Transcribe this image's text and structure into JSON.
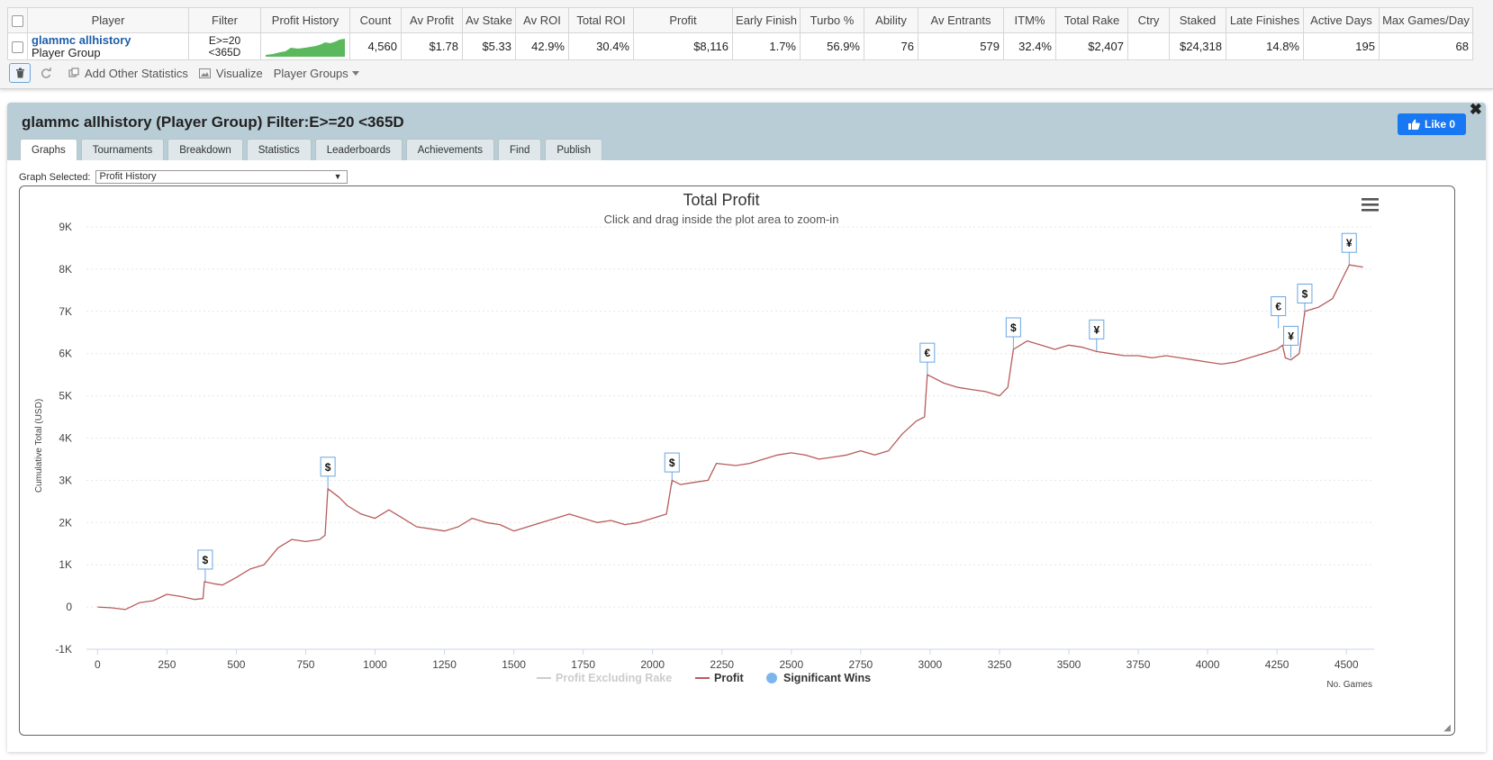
{
  "stats_table": {
    "columns": [
      "Player",
      "Filter",
      "Profit History",
      "Count",
      "Av Profit",
      "Av Stake",
      "Av ROI",
      "Total ROI",
      "Profit",
      "Early Finish",
      "Turbo %",
      "Ability",
      "Av Entrants",
      "ITM%",
      "Total Rake",
      "Ctry",
      "Staked",
      "Late Finishes",
      "Active Days",
      "Max Games/Day"
    ],
    "row": {
      "player_name": "glammc allhistory",
      "player_type": "Player Group",
      "filter": "E>=20 <365D",
      "count": "4,560",
      "av_profit": "$1.78",
      "av_stake": "$5.33",
      "av_roi": "42.9%",
      "total_roi": "30.4%",
      "profit": "$8,116",
      "early_finish": "1.7%",
      "turbo": "56.9%",
      "ability": "76",
      "av_entrants": "579",
      "itm": "32.4%",
      "total_rake": "$2,407",
      "ctry": "",
      "staked": "$24,318",
      "late_finishes": "14.8%",
      "active_days": "195",
      "max_games_day": "68"
    }
  },
  "toolbar": {
    "add_stats": "Add Other Statistics",
    "visualize": "Visualize",
    "player_groups": "Player Groups"
  },
  "panel": {
    "title": "glammc allhistory (Player Group) Filter:E>=20 <365D",
    "like_label": "Like 0",
    "close": "✖",
    "tabs": [
      "Graphs",
      "Tournaments",
      "Breakdown",
      "Statistics",
      "Leaderboards",
      "Achievements",
      "Find",
      "Publish"
    ],
    "active_tab": "Graphs",
    "graph_selected_label": "Graph Selected:",
    "graph_selected_value": "Profit History"
  },
  "colors": {
    "profit_line": "#b85c5c",
    "flag_border": "#6aa6e0",
    "win_dot": "#7cb5ec",
    "legend_grey": "#cccccc"
  },
  "chart_data": {
    "type": "line",
    "title": "Total Profit",
    "subtitle": "Click and drag inside the plot area to zoom-in",
    "ylabel": "Cumulative Total (USD)",
    "xlabel": "No. Games",
    "xlim": [
      -40,
      4600
    ],
    "ylim": [
      -1000,
      9000
    ],
    "x_ticks": [
      0,
      250,
      500,
      750,
      1000,
      1250,
      1500,
      1750,
      2000,
      2250,
      2500,
      2750,
      3000,
      3250,
      3500,
      3750,
      4000,
      4250,
      4500
    ],
    "y_ticks": [
      -1000,
      0,
      1000,
      2000,
      3000,
      4000,
      5000,
      6000,
      7000,
      8000,
      9000
    ],
    "y_tick_labels": [
      "-1K",
      "0",
      "1K",
      "2K",
      "3K",
      "4K",
      "5K",
      "6K",
      "7K",
      "8K",
      "9K"
    ],
    "legend": [
      "Profit Excluding Rake",
      "Profit",
      "Significant Wins"
    ],
    "legend_position": "bottom-center",
    "grid": true,
    "series": [
      {
        "name": "Profit",
        "points": [
          [
            0,
            0
          ],
          [
            50,
            -20
          ],
          [
            100,
            -60
          ],
          [
            150,
            100
          ],
          [
            200,
            150
          ],
          [
            250,
            300
          ],
          [
            300,
            250
          ],
          [
            350,
            180
          ],
          [
            380,
            200
          ],
          [
            385,
            600
          ],
          [
            420,
            550
          ],
          [
            450,
            520
          ],
          [
            500,
            700
          ],
          [
            550,
            900
          ],
          [
            600,
            1000
          ],
          [
            650,
            1400
          ],
          [
            700,
            1600
          ],
          [
            750,
            1550
          ],
          [
            800,
            1600
          ],
          [
            820,
            1700
          ],
          [
            830,
            2800
          ],
          [
            870,
            2600
          ],
          [
            900,
            2400
          ],
          [
            950,
            2200
          ],
          [
            1000,
            2100
          ],
          [
            1050,
            2300
          ],
          [
            1100,
            2100
          ],
          [
            1150,
            1900
          ],
          [
            1200,
            1850
          ],
          [
            1250,
            1800
          ],
          [
            1300,
            1900
          ],
          [
            1350,
            2100
          ],
          [
            1400,
            2000
          ],
          [
            1450,
            1950
          ],
          [
            1500,
            1800
          ],
          [
            1550,
            1900
          ],
          [
            1600,
            2000
          ],
          [
            1650,
            2100
          ],
          [
            1700,
            2200
          ],
          [
            1750,
            2100
          ],
          [
            1800,
            2000
          ],
          [
            1850,
            2050
          ],
          [
            1900,
            1950
          ],
          [
            1950,
            2000
          ],
          [
            2000,
            2100
          ],
          [
            2050,
            2200
          ],
          [
            2070,
            3000
          ],
          [
            2100,
            2900
          ],
          [
            2150,
            2950
          ],
          [
            2200,
            3000
          ],
          [
            2230,
            3400
          ],
          [
            2300,
            3350
          ],
          [
            2350,
            3400
          ],
          [
            2400,
            3500
          ],
          [
            2450,
            3600
          ],
          [
            2500,
            3650
          ],
          [
            2550,
            3600
          ],
          [
            2600,
            3500
          ],
          [
            2650,
            3550
          ],
          [
            2700,
            3600
          ],
          [
            2750,
            3700
          ],
          [
            2800,
            3600
          ],
          [
            2850,
            3700
          ],
          [
            2900,
            4100
          ],
          [
            2950,
            4400
          ],
          [
            2980,
            4500
          ],
          [
            2990,
            5500
          ],
          [
            3050,
            5300
          ],
          [
            3100,
            5200
          ],
          [
            3150,
            5150
          ],
          [
            3200,
            5100
          ],
          [
            3250,
            5000
          ],
          [
            3280,
            5200
          ],
          [
            3300,
            6100
          ],
          [
            3350,
            6300
          ],
          [
            3400,
            6200
          ],
          [
            3450,
            6100
          ],
          [
            3500,
            6200
          ],
          [
            3550,
            6150
          ],
          [
            3600,
            6050
          ],
          [
            3650,
            6000
          ],
          [
            3700,
            5950
          ],
          [
            3750,
            5950
          ],
          [
            3800,
            5900
          ],
          [
            3850,
            5950
          ],
          [
            3900,
            5900
          ],
          [
            3950,
            5850
          ],
          [
            4000,
            5800
          ],
          [
            4050,
            5750
          ],
          [
            4100,
            5800
          ],
          [
            4150,
            5900
          ],
          [
            4200,
            6000
          ],
          [
            4250,
            6100
          ],
          [
            4270,
            6200
          ],
          [
            4280,
            5900
          ],
          [
            4300,
            5850
          ],
          [
            4330,
            6000
          ],
          [
            4350,
            7000
          ],
          [
            4400,
            7100
          ],
          [
            4450,
            7300
          ],
          [
            4480,
            7700
          ],
          [
            4510,
            8100
          ],
          [
            4560,
            8050
          ]
        ]
      }
    ],
    "significant_wins": [
      {
        "x": 388,
        "y": 600,
        "label": "$"
      },
      {
        "x": 830,
        "y": 2800,
        "label": "$"
      },
      {
        "x": 2070,
        "y": 2900,
        "label": "$"
      },
      {
        "x": 2990,
        "y": 5500,
        "label": "€"
      },
      {
        "x": 3300,
        "y": 6100,
        "label": "$"
      },
      {
        "x": 3600,
        "y": 6050,
        "label": "¥"
      },
      {
        "x": 4255,
        "y": 6600,
        "label": "€"
      },
      {
        "x": 4300,
        "y": 5900,
        "label": "¥"
      },
      {
        "x": 4350,
        "y": 6900,
        "label": "$"
      },
      {
        "x": 4510,
        "y": 8100,
        "label": "¥"
      }
    ]
  }
}
